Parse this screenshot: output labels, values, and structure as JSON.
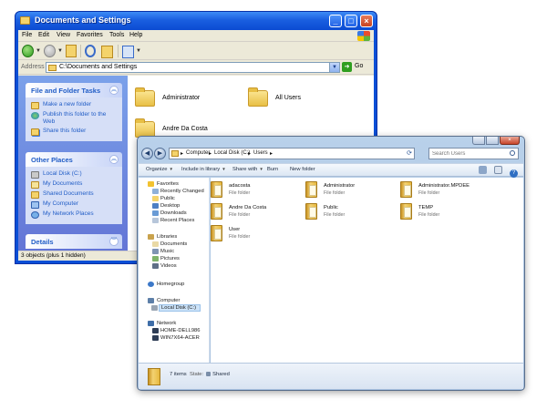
{
  "xp": {
    "title": "Documents and Settings",
    "menu": [
      "File",
      "Edit",
      "View",
      "Favorites",
      "Tools",
      "Help"
    ],
    "address_label": "Address",
    "address_value": "C:\\Documents and Settings",
    "go_label": "Go",
    "panels": {
      "tasks": {
        "title": "File and Folder Tasks",
        "items": [
          "Make a new folder",
          "Publish this folder to the Web",
          "Share this folder"
        ]
      },
      "places": {
        "title": "Other Places",
        "items": [
          "Local Disk (C:)",
          "My Documents",
          "Shared Documents",
          "My Computer",
          "My Network Places"
        ]
      },
      "details": {
        "title": "Details"
      }
    },
    "folders": [
      "Administrator",
      "All Users",
      "Andre Da Costa"
    ],
    "status": "3 objects (plus 1 hidden)"
  },
  "w7": {
    "breadcrumb": [
      "Computer",
      "Local Disk (C:)",
      "Users"
    ],
    "search_placeholder": "Search Users",
    "commands": [
      "Organize",
      "Include in library",
      "Share with",
      "Burn",
      "New folder"
    ],
    "nav": {
      "favorites": {
        "label": "Favorites",
        "items": [
          "Recently Changed",
          "Public",
          "Desktop",
          "Downloads",
          "Recent Places"
        ]
      },
      "libraries": {
        "label": "Libraries",
        "items": [
          "Documents",
          "Music",
          "Pictures",
          "Videos"
        ]
      },
      "homegroup": "Homegroup",
      "computer": {
        "label": "Computer",
        "items": [
          "Local Disk (C:)"
        ]
      },
      "network": {
        "label": "Network",
        "items": [
          "HOME-DELL986",
          "WIN7X64-ACER"
        ]
      }
    },
    "files": [
      {
        "name": "adacosta",
        "type": "File folder"
      },
      {
        "name": "Administrator",
        "type": "File folder"
      },
      {
        "name": "Administrator.MPDEE",
        "type": "File folder"
      },
      {
        "name": "Andre Da Costa",
        "type": "File folder"
      },
      {
        "name": "Public",
        "type": "File folder"
      },
      {
        "name": "TEMP",
        "type": "File folder"
      },
      {
        "name": "User",
        "type": "File folder"
      }
    ],
    "details": {
      "count": "7 items",
      "state_label": "State:",
      "state_value": "Shared"
    }
  }
}
